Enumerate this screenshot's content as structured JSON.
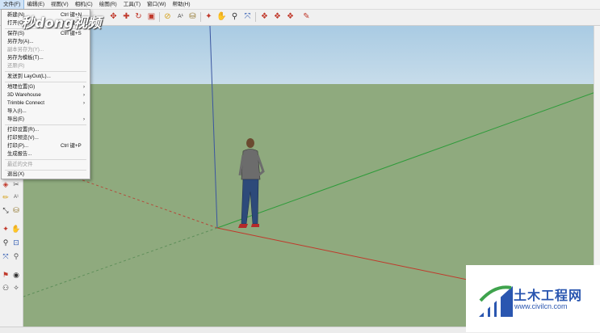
{
  "menubar": {
    "items": [
      "文件(F)",
      "编辑(E)",
      "视图(V)",
      "相机(C)",
      "绘图(R)",
      "工具(T)",
      "窗口(W)",
      "帮助(H)"
    ]
  },
  "file_menu": {
    "items": [
      {
        "label": "新建(N)",
        "shortcut": "Ctrl 键+N"
      },
      {
        "label": "打开(O)...",
        "shortcut": "Ctrl 键+O"
      },
      {
        "label": "保存(S)",
        "shortcut": "Ctrl 键+S"
      },
      {
        "label": "另存为(A)...",
        "shortcut": ""
      },
      {
        "label": "副本另存为(Y)...",
        "shortcut": ""
      },
      {
        "label": "另存为模板(T)...",
        "shortcut": ""
      },
      {
        "label": "还原(R)",
        "shortcut": ""
      },
      {
        "label": "发送到 LayOut(L)...",
        "shortcut": ""
      },
      {
        "label": "地理位置(G)",
        "shortcut": ""
      },
      {
        "label": "3D Warehouse",
        "shortcut": ""
      },
      {
        "label": "Trimble Connect",
        "shortcut": ""
      },
      {
        "label": "导入(I)...",
        "shortcut": ""
      },
      {
        "label": "导出(E)",
        "shortcut": ""
      },
      {
        "label": "打印设置(R)...",
        "shortcut": ""
      },
      {
        "label": "打印预览(V)...",
        "shortcut": ""
      },
      {
        "label": "打印(P)...",
        "shortcut": "Ctrl 键+P"
      },
      {
        "label": "生成报告...",
        "shortcut": ""
      },
      {
        "label": "最近的文件",
        "shortcut": ""
      },
      {
        "label": "退出(X)",
        "shortcut": ""
      }
    ]
  },
  "watermark": {
    "text": "秒dong视频"
  },
  "site_logo": {
    "name": "土木工程网",
    "url": "www.civilcn.com"
  },
  "colors": {
    "sky": "#a9cbe3",
    "ground": "#8faa7e",
    "axis_red": "#c0392b",
    "axis_green": "#2e9b3a",
    "axis_blue": "#3a55a0"
  }
}
